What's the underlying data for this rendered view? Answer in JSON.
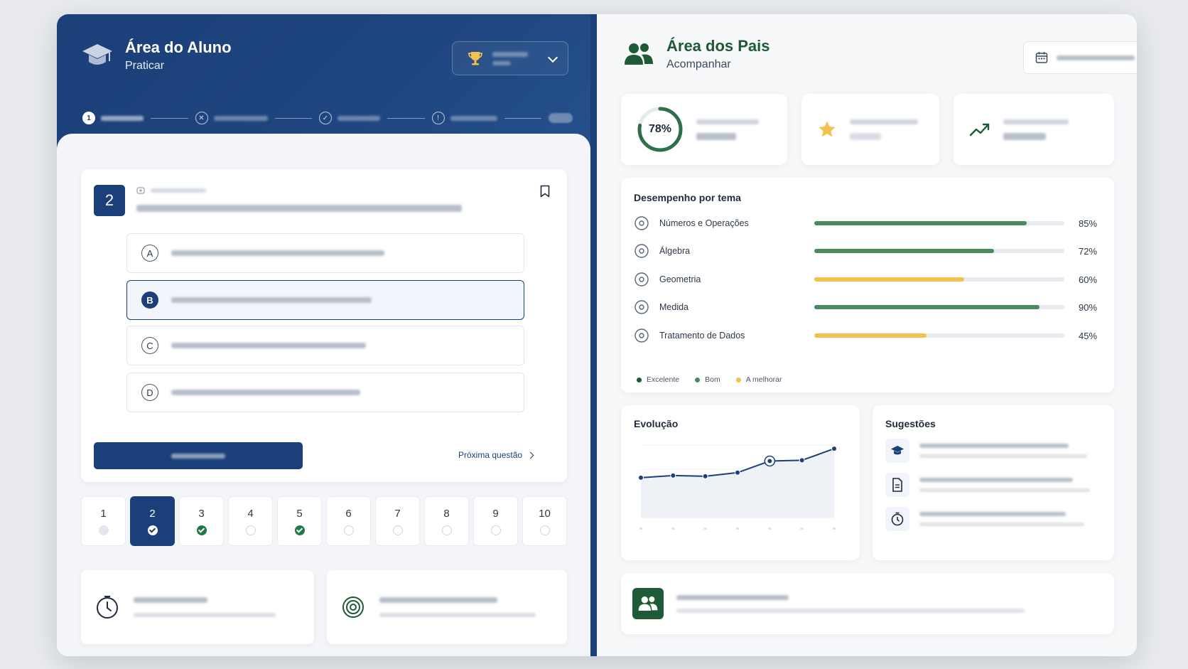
{
  "student": {
    "title": "Área do Aluno",
    "subtitle": "Praticar",
    "question_number": "2",
    "options": [
      {
        "letter": "A"
      },
      {
        "letter": "B",
        "selected": true
      },
      {
        "letter": "C"
      },
      {
        "letter": "D"
      }
    ],
    "next_label": "Próxima questão",
    "nav": [
      {
        "n": "1",
        "state": "viewed"
      },
      {
        "n": "2",
        "state": "current"
      },
      {
        "n": "3",
        "state": "done"
      },
      {
        "n": "4",
        "state": "empty"
      },
      {
        "n": "5",
        "state": "done"
      },
      {
        "n": "6",
        "state": "empty"
      },
      {
        "n": "7",
        "state": "empty"
      },
      {
        "n": "8",
        "state": "empty"
      },
      {
        "n": "9",
        "state": "empty"
      },
      {
        "n": "10",
        "state": "empty"
      }
    ],
    "stepper": {
      "first_step": "1"
    }
  },
  "parents": {
    "title": "Área dos Pais",
    "subtitle": "Acompanhar",
    "progress_value": "78%",
    "progress_fraction": 0.78,
    "performance": {
      "title": "Desempenho por tema",
      "topics": [
        {
          "label": "Números e Operações",
          "pct": "85%",
          "value": 85,
          "color": "#4a8a5c",
          "icon": "number-circle-icon"
        },
        {
          "label": "Álgebra",
          "pct": "72%",
          "value": 72,
          "color": "#4a8a5c",
          "icon": "algebra-icon"
        },
        {
          "label": "Geometria",
          "pct": "60%",
          "value": 60,
          "color": "#f2c14e",
          "icon": "geometry-icon"
        },
        {
          "label": "Medida",
          "pct": "90%",
          "value": 90,
          "color": "#4a8a5c",
          "icon": "measure-icon"
        },
        {
          "label": "Tratamento de Dados",
          "pct": "45%",
          "value": 45,
          "color": "#f2c14e",
          "icon": "data-chart-icon"
        }
      ],
      "legend": [
        {
          "label": "Excelente",
          "color": "#1e5a36"
        },
        {
          "label": "Bom",
          "color": "#4a8a5c"
        },
        {
          "label": "A melhorar",
          "color": "#f2c14e"
        }
      ]
    },
    "evolution": {
      "title": "Evolução",
      "points": [
        0.55,
        0.58,
        0.57,
        0.62,
        0.78,
        0.79,
        0.95
      ],
      "highlight_index": 4
    },
    "suggestions": {
      "title": "Sugestões",
      "icons": [
        "graduation-cap-icon",
        "document-icon",
        "timer-icon"
      ]
    }
  },
  "colors": {
    "navy": "#1b3f78",
    "green_dark": "#1e5a36",
    "green": "#4a8a5c",
    "yellow": "#f2c14e"
  }
}
